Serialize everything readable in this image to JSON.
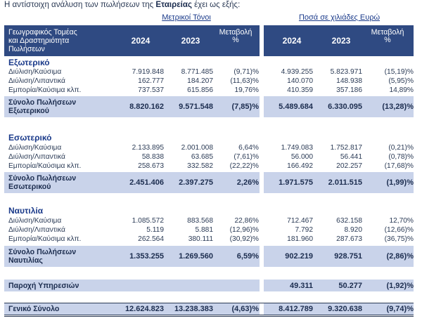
{
  "intro": {
    "before": "Η αντίστοιχη ανάλυση των πωλήσεων της ",
    "bold": "Εταιρείας",
    "after": " έχει ως εξής:"
  },
  "header": {
    "group_tonnes": "Μετρικοί Τόνοι",
    "group_euro": "Ποσά σε χιλιάδες Ευρώ",
    "label_line1": "Γεωγραφικός Τομέας",
    "label_line2": "και Δραστηριότητα",
    "label_line3": "Πωλήσεων",
    "y2024": "2024",
    "y2023": "2023",
    "chg_line1": "Μεταβολή",
    "chg_line2": "%"
  },
  "sections": [
    {
      "title": "Εξωτερικό",
      "rows": [
        {
          "label": "Διύλιση/Καύσιμα",
          "t24": "7.919.848",
          "t23": "8.771.485",
          "tchg": "(9,71)%",
          "e24": "4.939.255",
          "e23": "5.823.971",
          "echg": "(15,19)%"
        },
        {
          "label": "Διύλιση/Λιπαντικά",
          "t24": "162.777",
          "t23": "184.207",
          "tchg": "(11,63)%",
          "e24": "140.070",
          "e23": "148.938",
          "echg": "(5,95)%"
        },
        {
          "label": "Εμπορία/Καύσιμα κλπ.",
          "t24": "737.537",
          "t23": "615.856",
          "tchg": "19,76%",
          "e24": "410.359",
          "e23": "357.186",
          "echg": "14,89%"
        }
      ],
      "total": {
        "line1": "Σύνολο Πωλήσεων",
        "line2": "Εξωτερικού",
        "t24": "8.820.162",
        "t23": "9.571.548",
        "tchg": "(7,85)%",
        "e24": "5.489.684",
        "e23": "6.330.095",
        "echg": "(13,28)%"
      }
    },
    {
      "title": "Εσωτερικό",
      "rows": [
        {
          "label": "Διύλιση/Καύσιμα",
          "t24": "2.133.895",
          "t23": "2.001.008",
          "tchg": "6,64%",
          "e24": "1.749.083",
          "e23": "1.752.817",
          "echg": "(0,21)%"
        },
        {
          "label": "Διύλιση/Λιπαντικά",
          "t24": "58.838",
          "t23": "63.685",
          "tchg": "(7,61)%",
          "e24": "56.000",
          "e23": "56.441",
          "echg": "(0,78)%"
        },
        {
          "label": "Εμπορία/Καύσιμα κλπ.",
          "t24": "258.673",
          "t23": "332.582",
          "tchg": "(22,22)%",
          "e24": "166.492",
          "e23": "202.257",
          "echg": "(17,68)%"
        }
      ],
      "total": {
        "line1": "Σύνολο Πωλήσεων",
        "line2": "Εσωτερικού",
        "t24": "2.451.406",
        "t23": "2.397.275",
        "tchg": "2,26%",
        "e24": "1.971.575",
        "e23": "2.011.515",
        "echg": "(1,99)%"
      }
    },
    {
      "title": "Ναυτιλία",
      "rows": [
        {
          "label": "Διύλιση/Καύσιμα",
          "t24": "1.085.572",
          "t23": "883.568",
          "tchg": "22,86%",
          "e24": "712.467",
          "e23": "632.158",
          "echg": "12,70%"
        },
        {
          "label": "Διύλιση/Λιπαντικά",
          "t24": "5.119",
          "t23": "5.881",
          "tchg": "(12,96)%",
          "e24": "7.792",
          "e23": "8.920",
          "echg": "(12,66)%"
        },
        {
          "label": "Εμπορία/Καύσιμα κλπ.",
          "t24": "262.564",
          "t23": "380.111",
          "tchg": "(30,92)%",
          "e24": "181.960",
          "e23": "287.673",
          "echg": "(36,75)%"
        }
      ],
      "total": {
        "line1": "Σύνολο Πωλήσεων",
        "line2": "Ναυτιλίας",
        "t24": "1.353.255",
        "t23": "1.269.560",
        "tchg": "6,59%",
        "e24": "902.219",
        "e23": "928.751",
        "echg": "(2,86)%"
      }
    }
  ],
  "services": {
    "label": "Παροχή Υπηρεσιών",
    "e24": "49.311",
    "e23": "50.277",
    "echg": "(1,92)%"
  },
  "grand_total": {
    "label": "Γενικό Σύνολο",
    "t24": "12.624.823",
    "t23": "13.238.383",
    "tchg": "(4,63)%",
    "e24": "8.412.789",
    "e23": "9.320.638",
    "echg": "(9,74)%"
  },
  "colors": {
    "header_band": "#2f4a82",
    "total_band": "#c9d3ea",
    "accent_text": "#1a3a8a"
  }
}
